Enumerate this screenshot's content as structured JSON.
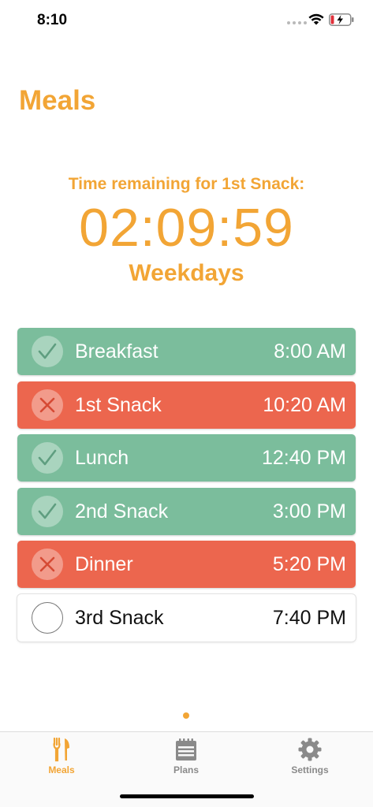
{
  "status_bar": {
    "time": "8:10"
  },
  "header": {
    "title": "Meals"
  },
  "countdown": {
    "label": "Time remaining for 1st Snack:",
    "value": "02:09:59",
    "schedule": "Weekdays"
  },
  "meals": [
    {
      "name": "Breakfast",
      "time": "8:00 AM",
      "status": "done"
    },
    {
      "name": "1st Snack",
      "time": "10:20 AM",
      "status": "missed"
    },
    {
      "name": "Lunch",
      "time": "12:40 PM",
      "status": "done"
    },
    {
      "name": "2nd Snack",
      "time": "3:00 PM",
      "status": "done"
    },
    {
      "name": "Dinner",
      "time": "5:20 PM",
      "status": "missed"
    },
    {
      "name": "3rd Snack",
      "time": "7:40 PM",
      "status": "pending"
    }
  ],
  "tabs": [
    {
      "label": "Meals",
      "icon": "fork-knife-icon",
      "active": true
    },
    {
      "label": "Plans",
      "icon": "calendar-icon",
      "active": false
    },
    {
      "label": "Settings",
      "icon": "gear-icon",
      "active": false
    }
  ],
  "colors": {
    "accent": "#f2a535",
    "done": "#7bbd9c",
    "missed": "#ec664e",
    "inactive_tab": "#8a8a8a"
  }
}
